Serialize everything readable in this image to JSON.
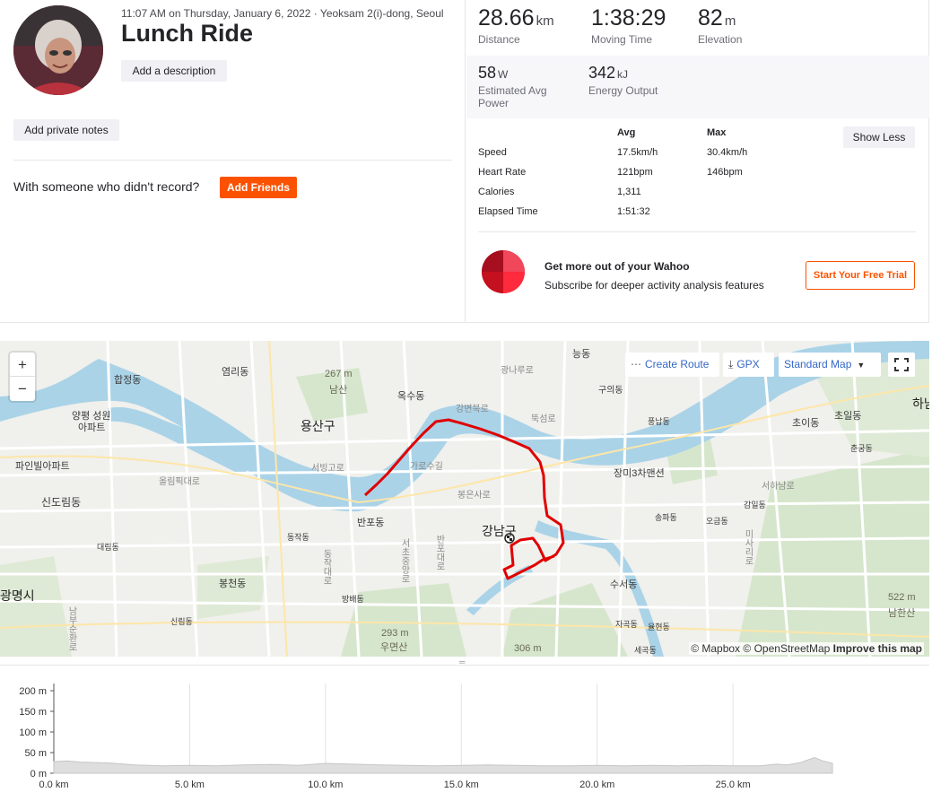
{
  "activity": {
    "meta_line": "11:07 AM on Thursday, January 6, 2022 · Yeoksam 2(i)-dong, Seoul",
    "title": "Lunch Ride",
    "add_description": "Add a description",
    "add_private_notes": "Add private notes",
    "with_someone": "With someone who didn't record?",
    "add_friends": "Add Friends"
  },
  "stats": {
    "distance": {
      "value": "28.66",
      "unit": "km",
      "label": "Distance"
    },
    "moving_time": {
      "value": "1:38:29",
      "label": "Moving Time"
    },
    "elevation": {
      "value": "82",
      "unit": "m",
      "label": "Elevation"
    },
    "power": {
      "value": "58",
      "unit": "W",
      "label": "Estimated Avg Power"
    },
    "energy": {
      "value": "342",
      "unit": "kJ",
      "label": "Energy Output"
    }
  },
  "table": {
    "col_avg": "Avg",
    "col_max": "Max",
    "show_less": "Show Less",
    "rows": [
      {
        "label": "Speed",
        "avg": "17.5km/h",
        "max": "30.4km/h"
      },
      {
        "label": "Heart Rate",
        "avg": "121bpm",
        "max": "146bpm"
      },
      {
        "label": "Calories",
        "avg": "1,311",
        "max": ""
      },
      {
        "label": "Elapsed Time",
        "avg": "1:51:32",
        "max": ""
      }
    ]
  },
  "promo": {
    "title": "Get more out of your Wahoo",
    "subtitle": "Subscribe for deeper activity analysis features",
    "button": "Start Your Free Trial",
    "logo_color": "#e0162b"
  },
  "map": {
    "zoom_in": "+",
    "zoom_out": "−",
    "create_route": "Create Route",
    "gpx": "GPX",
    "map_style": "Standard Map",
    "attribution_mapbox": "© Mapbox",
    "attribution_osm": "© OpenStreetMap",
    "improve": "Improve this map",
    "route_color": "#e00000",
    "labels": [
      {
        "name": "합정동"
      },
      {
        "name": "염리동"
      },
      {
        "name": "267 m"
      },
      {
        "name": "남산"
      },
      {
        "name": "옥수동"
      },
      {
        "name": "능동"
      },
      {
        "name": "광나루로"
      },
      {
        "name": "구의동"
      },
      {
        "name": "강변북로"
      },
      {
        "name": "뚝섬로"
      },
      {
        "name": "용산구"
      },
      {
        "name": "양평 성원"
      },
      {
        "name": "아파트"
      },
      {
        "name": "파인빌아파트"
      },
      {
        "name": "올림픽대로"
      },
      {
        "name": "서빙고로"
      },
      {
        "name": "가로수길"
      },
      {
        "name": "봉은사로"
      },
      {
        "name": "신도림동"
      },
      {
        "name": "반포동"
      },
      {
        "name": "동작동"
      },
      {
        "name": "서초중앙로"
      },
      {
        "name": "강남구"
      },
      {
        "name": "대림동"
      },
      {
        "name": "봉천동"
      },
      {
        "name": "방배동"
      },
      {
        "name": "신림동"
      },
      {
        "name": "293 m"
      },
      {
        "name": "우면산"
      },
      {
        "name": "306 m"
      },
      {
        "name": "수서동"
      },
      {
        "name": "자곡동"
      },
      {
        "name": "율현동"
      },
      {
        "name": "세곡동"
      },
      {
        "name": "장미3차맨션"
      },
      {
        "name": "송파동"
      },
      {
        "name": "오금동"
      },
      {
        "name": "감일동"
      },
      {
        "name": "서하남로"
      },
      {
        "name": "초이동"
      },
      {
        "name": "초일동"
      },
      {
        "name": "춘궁동"
      },
      {
        "name": "풍납동"
      },
      {
        "name": "522 m"
      },
      {
        "name": "남한산"
      },
      {
        "name": "광명시"
      },
      {
        "name": "하남"
      },
      {
        "name": "미사리로"
      },
      {
        "name": "동작대로"
      },
      {
        "name": "남부순환로"
      },
      {
        "name": "반포대로"
      }
    ]
  },
  "elevation_chart": {
    "type": "area",
    "ylabels": [
      "200 m",
      "150 m",
      "100 m",
      "50 m",
      "0 m"
    ],
    "xlabels": [
      "0.0 km",
      "5.0 km",
      "10.0 km",
      "15.0 km",
      "20.0 km",
      "25.0 km"
    ],
    "ylim": [
      0,
      200
    ],
    "xlim": [
      0,
      28.66
    ],
    "x": [
      0,
      0.5,
      1,
      2,
      3,
      4,
      5,
      6,
      7,
      8,
      9,
      10,
      11,
      12,
      13,
      14,
      15,
      16,
      17,
      18,
      19,
      20,
      21,
      22,
      23,
      24,
      25,
      26,
      26.6,
      27,
      27.5,
      28,
      28.3,
      28.66
    ],
    "y": [
      28,
      30,
      27,
      25,
      20,
      18,
      19,
      18,
      20,
      21,
      19,
      24,
      22,
      20,
      19,
      18,
      19,
      20,
      19,
      18,
      18,
      19,
      18,
      19,
      18,
      19,
      18,
      18,
      22,
      20,
      26,
      38,
      30,
      24
    ]
  }
}
